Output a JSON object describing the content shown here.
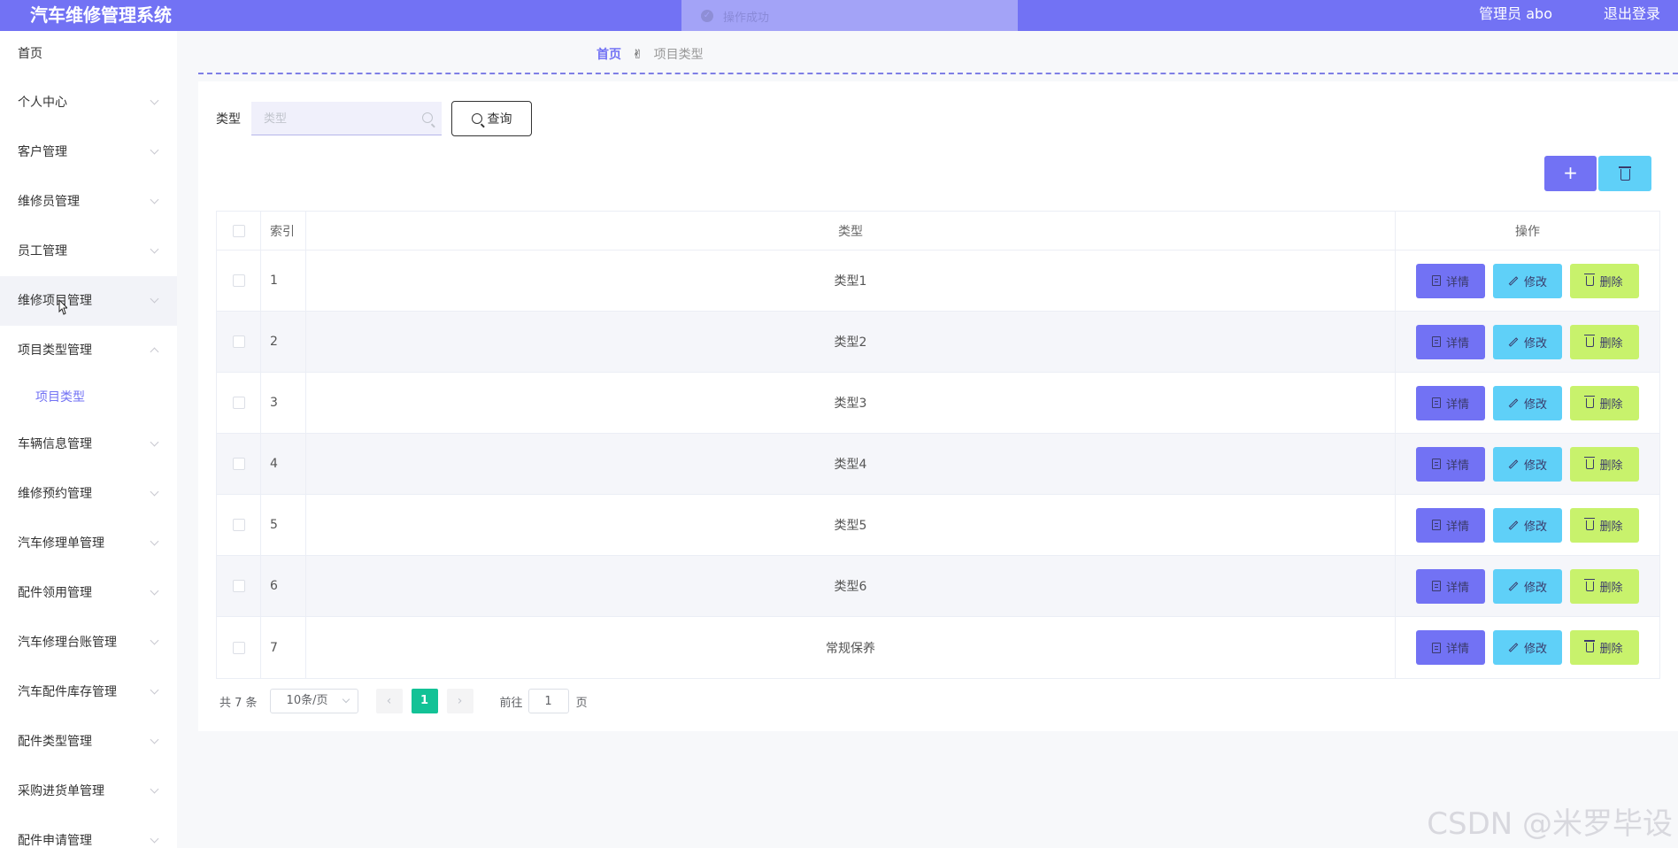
{
  "header": {
    "app_title": "汽车维修管理系统",
    "user_label": "管理员 abo",
    "logout_label": "退出登录"
  },
  "toast": {
    "message": "操作成功",
    "icon": "check-circle-icon"
  },
  "sidebar": {
    "items": [
      {
        "label": "首页",
        "expandable": false
      },
      {
        "label": "个人中心",
        "expandable": true
      },
      {
        "label": "客户管理",
        "expandable": true
      },
      {
        "label": "维修员管理",
        "expandable": true
      },
      {
        "label": "员工管理",
        "expandable": true
      },
      {
        "label": "维修项目管理",
        "expandable": true,
        "hover": true
      },
      {
        "label": "项目类型管理",
        "expandable": true,
        "expanded": true,
        "children": [
          {
            "label": "项目类型",
            "active": true
          }
        ]
      },
      {
        "label": "车辆信息管理",
        "expandable": true
      },
      {
        "label": "维修预约管理",
        "expandable": true
      },
      {
        "label": "汽车修理单管理",
        "expandable": true
      },
      {
        "label": "配件领用管理",
        "expandable": true
      },
      {
        "label": "汽车修理台账管理",
        "expandable": true
      },
      {
        "label": "汽车配件库存管理",
        "expandable": true
      },
      {
        "label": "配件类型管理",
        "expandable": true
      },
      {
        "label": "采购进货单管理",
        "expandable": true
      },
      {
        "label": "配件申请管理",
        "expandable": true
      }
    ]
  },
  "breadcrumb": {
    "home": "首页",
    "separator": "✌",
    "current": "项目类型"
  },
  "search": {
    "label": "类型",
    "placeholder": "类型",
    "value": "",
    "button_label": "查询"
  },
  "toolbar": {
    "add_label": "+",
    "add_color": "#7272f4",
    "batch_delete_color": "#5fd0f8"
  },
  "table": {
    "columns": [
      "索引",
      "类型",
      "操作"
    ],
    "rows": [
      {
        "index": "1",
        "type": "类型1"
      },
      {
        "index": "2",
        "type": "类型2"
      },
      {
        "index": "3",
        "type": "类型3"
      },
      {
        "index": "4",
        "type": "类型4"
      },
      {
        "index": "5",
        "type": "类型5"
      },
      {
        "index": "6",
        "type": "类型6"
      },
      {
        "index": "7",
        "type": "常规保养"
      }
    ],
    "actions": {
      "detail": "详情",
      "edit": "修改",
      "delete": "删除"
    },
    "action_colors": {
      "detail": "#7272f4",
      "edit": "#5fd0f8",
      "delete": "#c8f26c"
    }
  },
  "pagination": {
    "total_text": "共 7 条",
    "page_size": "10条/页",
    "current_page": "1",
    "goto_prefix": "前往",
    "goto_value": "1",
    "goto_suffix": "页",
    "prev_icon": "chevron-left-icon",
    "next_icon": "chevron-right-icon"
  },
  "watermark": "CSDN @米罗毕设"
}
